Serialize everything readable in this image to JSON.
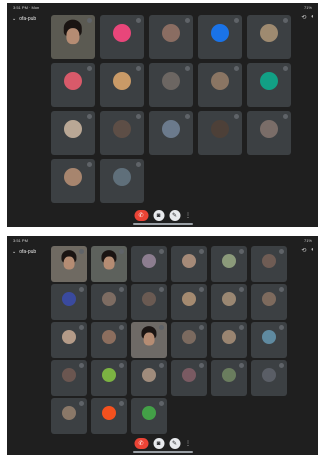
{
  "screens": [
    {
      "status_left": "3:51 PM · Mon",
      "status_right": "71%",
      "meeting_code": "ofa-pub",
      "tiles": [
        {
          "name": "",
          "type": "video",
          "color": "#5b5a52"
        },
        {
          "name": "",
          "type": "avatar",
          "color": "#e8467a",
          "initial": ""
        },
        {
          "name": "",
          "type": "avatar",
          "color": "#8a6d62",
          "initial": ""
        },
        {
          "name": "",
          "type": "avatar",
          "color": "#1a73e8",
          "initial": ""
        },
        {
          "name": "",
          "type": "avatar",
          "color": "#9e8a70",
          "initial": ""
        },
        {
          "name": "",
          "type": "avatar",
          "color": "#d85a6a",
          "initial": ""
        },
        {
          "name": "",
          "type": "avatar",
          "color": "#c99a67",
          "initial": ""
        },
        {
          "name": "",
          "type": "avatar",
          "color": "#6c6662",
          "initial": ""
        },
        {
          "name": "",
          "type": "avatar",
          "color": "#8a7563",
          "initial": ""
        },
        {
          "name": "",
          "type": "avatar",
          "color": "#12a085",
          "initial": ""
        },
        {
          "name": "",
          "type": "avatar",
          "color": "#b9a795",
          "initial": ""
        },
        {
          "name": "",
          "type": "avatar",
          "color": "#5d4e46",
          "initial": ""
        },
        {
          "name": "",
          "type": "avatar",
          "color": "#6b7a8c",
          "initial": ""
        },
        {
          "name": "",
          "type": "avatar",
          "color": "#4d4038",
          "initial": ""
        },
        {
          "name": "",
          "type": "avatar",
          "color": "#7a6d68",
          "initial": ""
        },
        {
          "name": "",
          "type": "avatar",
          "color": "#a7856e",
          "initial": ""
        },
        {
          "name": "",
          "type": "avatar",
          "color": "#5f6f7a",
          "initial": ""
        }
      ]
    },
    {
      "status_left": "3:51 PM",
      "status_right": "71%",
      "meeting_code": "ofa-pub",
      "tiles": [
        {
          "name": "",
          "type": "video",
          "color": "#6f6a62"
        },
        {
          "name": "",
          "type": "video",
          "color": "#5d615c"
        },
        {
          "name": "",
          "type": "avatar",
          "color": "#8c7d8f",
          "initial": ""
        },
        {
          "name": "",
          "type": "avatar",
          "color": "#a58a78",
          "initial": ""
        },
        {
          "name": "",
          "type": "avatar",
          "color": "#8b9a7a",
          "initial": ""
        },
        {
          "name": "",
          "type": "avatar",
          "color": "#6f5c54",
          "initial": ""
        },
        {
          "name": "",
          "type": "avatar",
          "color": "#3a4a9e",
          "initial": ""
        },
        {
          "name": "",
          "type": "avatar",
          "color": "#7d6c62",
          "initial": ""
        },
        {
          "name": "",
          "type": "avatar",
          "color": "#6a5a52",
          "initial": ""
        },
        {
          "name": "",
          "type": "avatar",
          "color": "#a48a70",
          "initial": ""
        },
        {
          "name": "",
          "type": "avatar",
          "color": "#9a8772",
          "initial": ""
        },
        {
          "name": "",
          "type": "avatar",
          "color": "#7d6a5d",
          "initial": ""
        },
        {
          "name": "",
          "type": "avatar",
          "color": "#b49b88",
          "initial": ""
        },
        {
          "name": "",
          "type": "avatar",
          "color": "#8c6e5e",
          "initial": ""
        },
        {
          "name": "",
          "type": "video",
          "color": "#6e6a66"
        },
        {
          "name": "",
          "type": "avatar",
          "color": "#7b6a5f",
          "initial": ""
        },
        {
          "name": "",
          "type": "avatar",
          "color": "#9a8571",
          "initial": ""
        },
        {
          "name": "",
          "type": "avatar",
          "color": "#5f8aa0",
          "initial": ""
        },
        {
          "name": "",
          "type": "avatar",
          "color": "#6b5650",
          "initial": ""
        },
        {
          "name": "",
          "type": "avatar",
          "color": "#7cb342",
          "initial": ""
        },
        {
          "name": "",
          "type": "avatar",
          "color": "#a08c7c",
          "initial": ""
        },
        {
          "name": "",
          "type": "avatar",
          "color": "#7a5a62",
          "initial": ""
        },
        {
          "name": "",
          "type": "avatar",
          "color": "#6a7d5e",
          "initial": ""
        },
        {
          "name": "",
          "type": "avatar",
          "color": "#5a5e66",
          "initial": ""
        },
        {
          "name": "",
          "type": "avatar",
          "color": "#8a7868",
          "initial": ""
        },
        {
          "name": "",
          "type": "avatar",
          "color": "#f4511e",
          "initial": ""
        },
        {
          "name": "",
          "type": "avatar",
          "color": "#43a047",
          "initial": ""
        }
      ]
    }
  ],
  "controls": {
    "end_icon": "call-end-icon",
    "cam_icon": "camera-icon",
    "mic_icon": "mic-icon",
    "more_icon": "more-icon"
  },
  "icons": {
    "back": "chevron-down-icon",
    "rotate": "rotate-camera-icon",
    "audio": "audio-output-icon"
  }
}
